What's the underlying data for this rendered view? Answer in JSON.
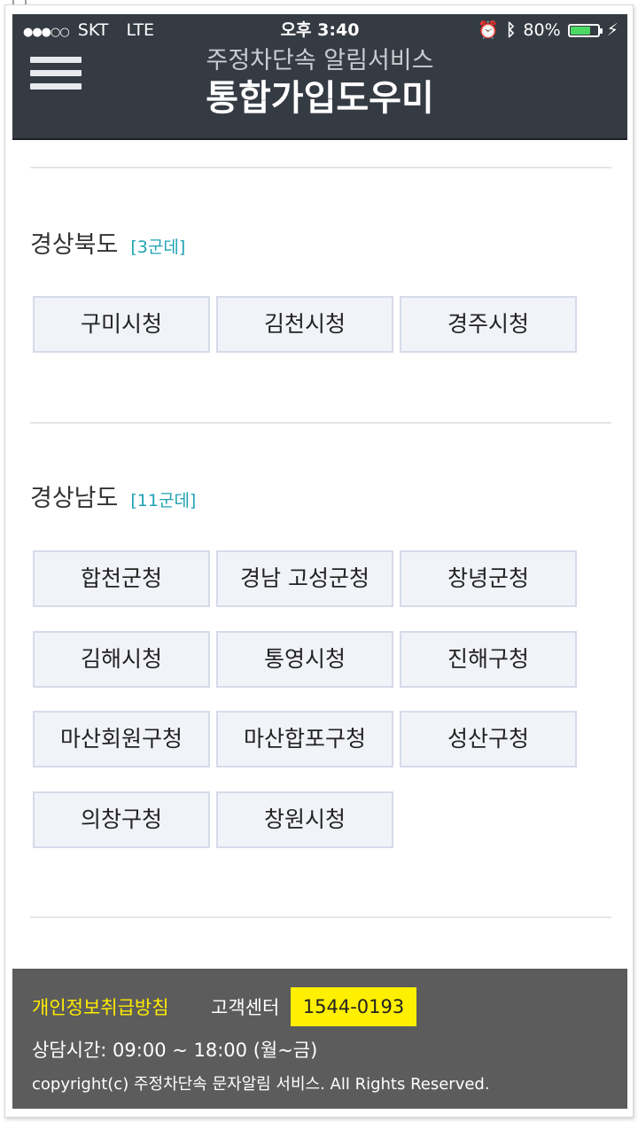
{
  "statusbar": {
    "carrier": "SKT",
    "network": "LTE",
    "time": "오후 3:40",
    "battery": "80%",
    "battery_level": 0.8
  },
  "header": {
    "subtitle": "주정차단속 알림서비스",
    "title": "통합가입도우미"
  },
  "sections": [
    {
      "title": "경상북도",
      "count": "[3군데]",
      "items": [
        "구미시청",
        "김천시청",
        "경주시청"
      ]
    },
    {
      "title": "경상남도",
      "count": "[11군데]",
      "items": [
        "합천군청",
        "경남 고성군청",
        "창녕군청",
        "김해시청",
        "통영시청",
        "진해구청",
        "마산회원구청",
        "마산합포구청",
        "성산구청",
        "의창구청",
        "창원시청"
      ]
    }
  ],
  "footer": {
    "privacy": "개인정보취급방침",
    "cs_label": "고객센터",
    "phone": "1544-0193",
    "hours": "상담시간: 09:00 ~ 18:00 (월~금)",
    "copyright": "copyright(c) 주정차단속 문자알림 서비스. All Rights Reserved."
  }
}
